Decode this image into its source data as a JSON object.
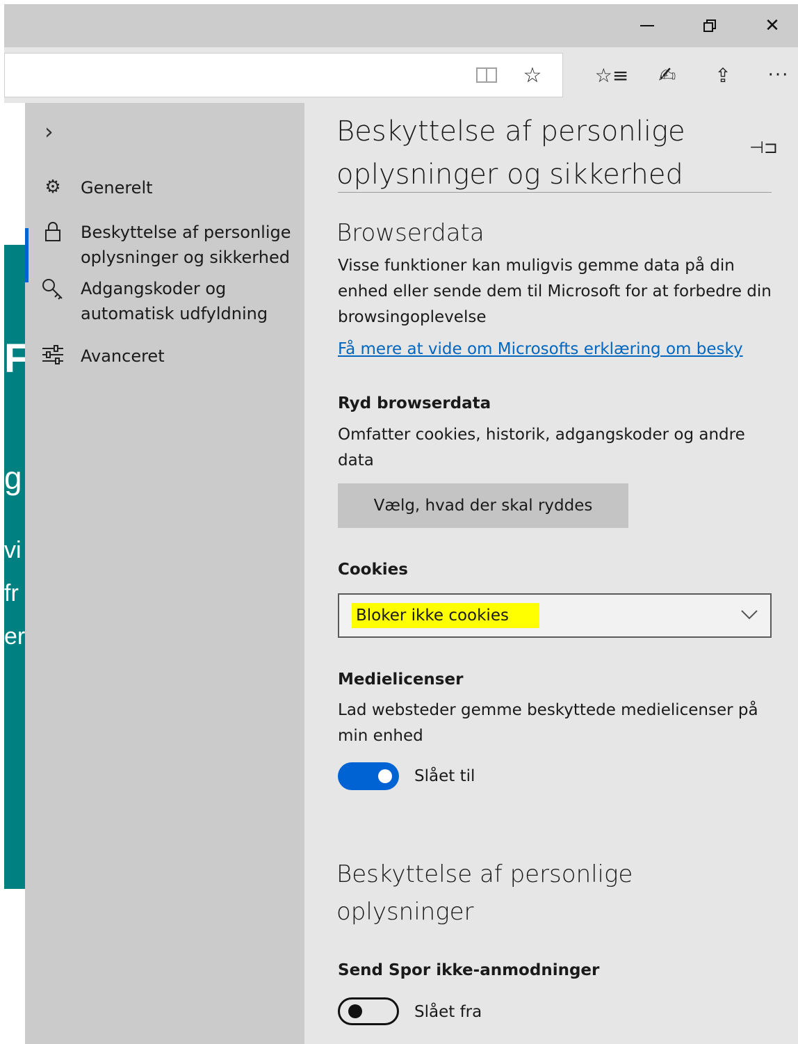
{
  "window": {
    "minimize_glyph": "",
    "close_glyph": "✕"
  },
  "toolbar": {
    "star_glyph": "☆",
    "favorites_glyph": "☆≡",
    "pen_glyph": "✍",
    "share_glyph": "⇪",
    "more_glyph": "···"
  },
  "page_fragments": [
    "F",
    "g",
    "vi",
    "fr",
    "er"
  ],
  "nav": {
    "chevron": "›",
    "items": [
      {
        "label": "Generelt",
        "icon": "gear-icon"
      },
      {
        "label": "Beskyttelse af personlige oplysninger og sikkerhed",
        "icon": "lock-icon"
      },
      {
        "label": "Adgangskoder og automatisk udfyldning",
        "icon": "key-icon"
      },
      {
        "label": "Avanceret",
        "icon": "sliders-icon"
      }
    ],
    "active_index": 1
  },
  "content": {
    "title": "Beskyttelse af personlige oplysninger og sikkerhed",
    "pin_glyph": "⊣⊐",
    "browserdata": {
      "heading": "Browserdata",
      "description": "Visse funktioner kan muligvis gemme data på din enhed eller sende dem til Microsoft for at forbedre din browsingoplevelse",
      "link": "Få mere at vide om Microsofts erklæring om besky"
    },
    "clear": {
      "label": "Ryd browserdata",
      "description": "Omfatter cookies, historik, adgangskoder og andre data",
      "button": "Vælg, hvad der skal ryddes"
    },
    "cookies": {
      "label": "Cookies",
      "selected": "Bloker ikke cookies",
      "highlight_color": "#ffff00"
    },
    "media": {
      "label": "Medielicenser",
      "description": "Lad websteder gemme beskyttede medielicenser på min enhed",
      "toggle_state": "Slået til",
      "toggle_on": true
    },
    "privacy": {
      "heading": "Beskyttelse af personlige oplysninger",
      "dnt_label": "Send Spor ikke-anmodninger",
      "toggle_state": "Slået fra",
      "toggle_on": false
    }
  },
  "colors": {
    "accent": "#0063d3",
    "link": "#0067c0",
    "page_teal": "#008080"
  }
}
